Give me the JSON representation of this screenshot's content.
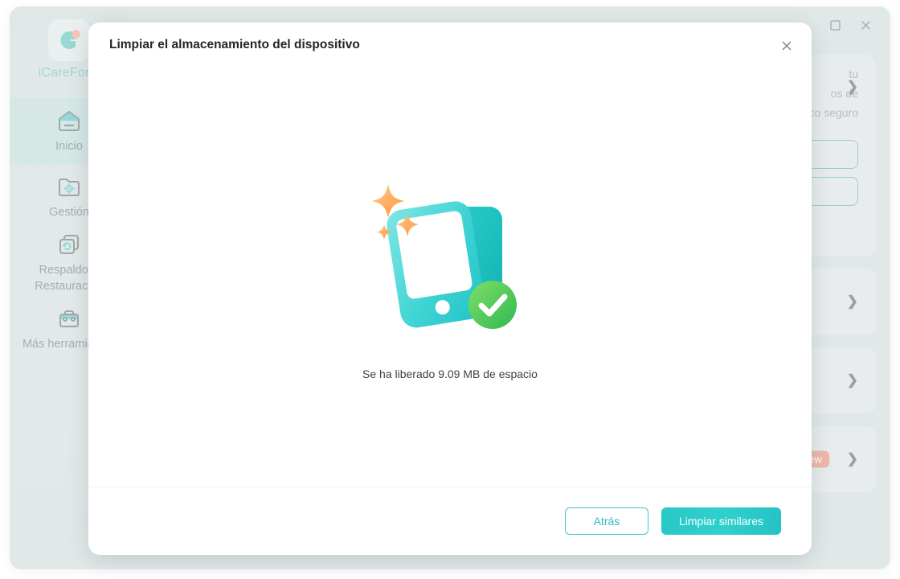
{
  "window": {
    "controls": [
      {
        "name": "maximize-button",
        "icon": "square-icon",
        "label": ""
      },
      {
        "name": "close-button",
        "icon": "close-icon",
        "label": ""
      }
    ]
  },
  "sidebar": {
    "brand": {
      "name": "iCareFone",
      "logo_icon": "icarefone-logo-icon",
      "accent": "#27a8a4",
      "dot_color": "#f08060"
    },
    "items": [
      {
        "label": "Inicio",
        "icon": "home-icon",
        "active": true
      },
      {
        "label": "Gestión",
        "icon": "folder-gear-icon",
        "active": false
      },
      {
        "label": "Respaldo & Restauración",
        "icon": "backup-restore-icon",
        "active": false
      },
      {
        "label": "Más herramientas",
        "icon": "toolbox-icon",
        "active": false
      }
    ],
    "active_bg": "#a3ccc8"
  },
  "background": {
    "main_card": {
      "lines": [
        "tu",
        "os de",
        "co seguro"
      ],
      "chevron": "chevron-right-icon",
      "pill_count": 2
    },
    "cards": [
      {
        "chevron": "chevron-right-icon",
        "badge": ""
      },
      {
        "chevron": "chevron-right-icon",
        "badge": ""
      },
      {
        "chevron": "chevron-right-icon",
        "badge": "New"
      }
    ],
    "badge_color": "#d9623f"
  },
  "modal": {
    "title": "Limpiar el almacenamiento del dispositivo",
    "close_icon": "close-icon",
    "illustration": {
      "name": "clean-success-illustration",
      "phone_color": "#3fd0d0",
      "phone_back_color": "#23bdbd",
      "sparkle_color": "#ffa95e",
      "check_color": "#4cc764"
    },
    "status_text": "Se ha liberado 9.09 MB de espacio",
    "footer": {
      "back_label": "Atrás",
      "primary_label": "Limpiar similares",
      "primary_color": "#2ac8c8",
      "back_border_color": "#3fc6c9"
    }
  }
}
